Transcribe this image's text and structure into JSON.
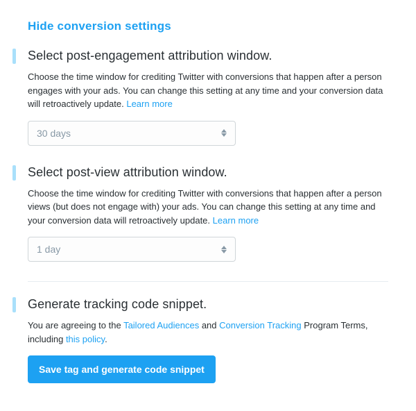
{
  "header": {
    "toggle_label": "Hide conversion settings"
  },
  "sections": [
    {
      "title": "Select post-engagement attribution window.",
      "desc_pre": "Choose the time window for crediting Twitter with conversions that happen after a person engages with your ads. You can change this setting at any time and your conversion data will retroactively update. ",
      "learn_more": "Learn more",
      "select_value": "30 days"
    },
    {
      "title": "Select post-view attribution window.",
      "desc_pre": "Choose the time window for crediting Twitter with conversions that happen after a person views (but does not engage with) your ads. You can change this setting at any time and your conversion data will retroactively update. ",
      "learn_more": "Learn more",
      "select_value": "1 day"
    }
  ],
  "generate": {
    "title": "Generate tracking code snippet.",
    "agree_pre": "You are agreeing to the ",
    "link_tailored": "Tailored Audiences",
    "agree_mid": " and ",
    "link_tracking": "Conversion Tracking",
    "agree_post": " Program Terms, including ",
    "link_policy": "this policy",
    "agree_end": ".",
    "button": "Save tag and generate code snippet"
  }
}
